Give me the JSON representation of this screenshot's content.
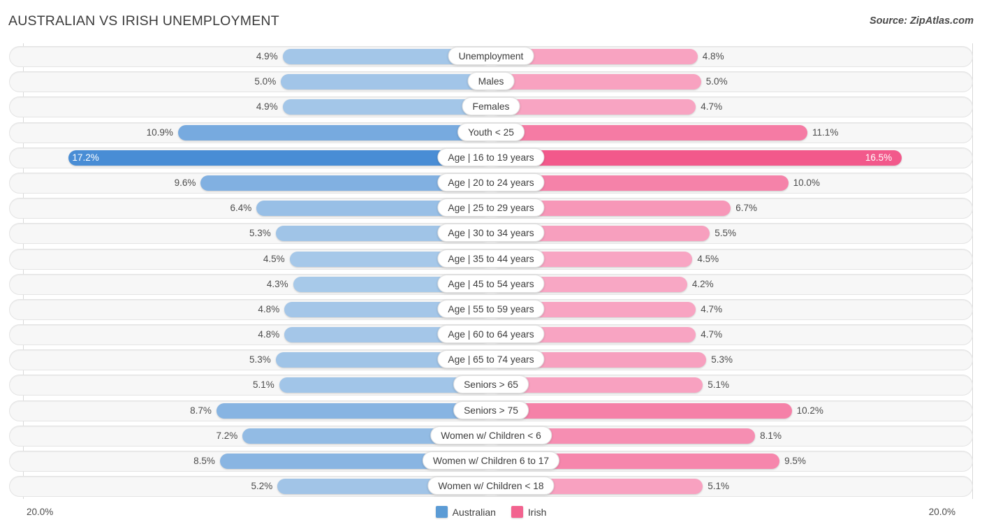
{
  "header": {
    "title": "AUSTRALIAN VS IRISH UNEMPLOYMENT",
    "source": "Source: ZipAtlas.com"
  },
  "legend": {
    "items": [
      {
        "label": "Australian",
        "color": "#5b9bd5"
      },
      {
        "label": "Irish",
        "color": "#f2638f"
      }
    ]
  },
  "axis": {
    "left_max_label": "20.0%",
    "right_max_label": "20.0%",
    "max_value": 20.0
  },
  "chart_data": {
    "type": "bar",
    "title": "AUSTRALIAN VS IRISH UNEMPLOYMENT",
    "subtype": "diverging-bidirectional",
    "xlabel": "",
    "ylabel": "",
    "xlim": [
      20.0,
      20.0
    ],
    "grid": false,
    "legend_position": "bottom-center",
    "categories": [
      "Unemployment",
      "Males",
      "Females",
      "Youth < 25",
      "Age | 16 to 19 years",
      "Age | 20 to 24 years",
      "Age | 25 to 29 years",
      "Age | 30 to 34 years",
      "Age | 35 to 44 years",
      "Age | 45 to 54 years",
      "Age | 55 to 59 years",
      "Age | 60 to 64 years",
      "Age | 65 to 74 years",
      "Seniors > 65",
      "Seniors > 75",
      "Women w/ Children < 6",
      "Women w/ Children 6 to 17",
      "Women w/ Children < 18"
    ],
    "series": [
      {
        "name": "Australian",
        "side": "left",
        "color": "#5b9bd5",
        "values": [
          4.9,
          5.0,
          4.9,
          10.9,
          17.2,
          9.6,
          6.4,
          5.3,
          4.5,
          4.3,
          4.8,
          4.8,
          5.3,
          5.1,
          8.7,
          7.2,
          8.5,
          5.2
        ],
        "labels": [
          "4.9%",
          "5.0%",
          "4.9%",
          "10.9%",
          "17.2%",
          "9.6%",
          "6.4%",
          "5.3%",
          "4.5%",
          "4.3%",
          "4.8%",
          "4.8%",
          "5.3%",
          "5.1%",
          "8.7%",
          "7.2%",
          "8.5%",
          "5.2%"
        ]
      },
      {
        "name": "Irish",
        "side": "right",
        "color": "#f2638f",
        "values": [
          4.8,
          5.0,
          4.7,
          11.1,
          16.5,
          10.0,
          6.7,
          5.5,
          4.5,
          4.2,
          4.7,
          4.7,
          5.3,
          5.1,
          10.2,
          8.1,
          9.5,
          5.1
        ],
        "labels": [
          "4.8%",
          "5.0%",
          "4.7%",
          "11.1%",
          "16.5%",
          "10.0%",
          "6.7%",
          "5.5%",
          "4.5%",
          "4.2%",
          "4.7%",
          "4.7%",
          "5.3%",
          "5.1%",
          "10.2%",
          "8.1%",
          "9.5%",
          "5.1%"
        ]
      }
    ]
  }
}
